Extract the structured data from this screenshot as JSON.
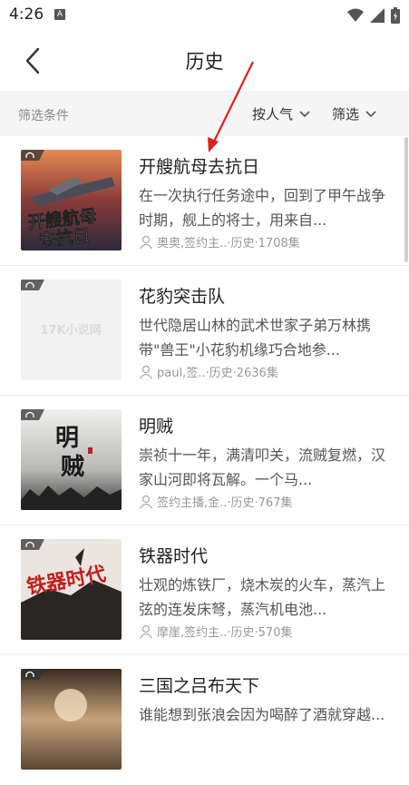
{
  "status": {
    "time": "4:26"
  },
  "header": {
    "title": "历史"
  },
  "filter": {
    "label": "筛选条件",
    "sort": "按人气",
    "filter": "筛选"
  },
  "items": [
    {
      "title": "开艘航母去抗日",
      "desc": "在一次执行任务途中，回到了甲午战争时期，舰上的将士，用来自...",
      "meta": "奥奥,签约主..·历史·1708集",
      "cover_text": "开艘航母去抗日"
    },
    {
      "title": "花豹突击队",
      "desc": "世代隐居山林的武术世家子弟万林携带\"兽王\"小花豹机缘巧合地参...",
      "meta": "paul,签..·历史·2636集",
      "cover_text": "17K小说网"
    },
    {
      "title": "明贼",
      "desc": "崇祯十一年，满清叩关，流贼复燃，汉家山河即将瓦解。一个马...",
      "meta": "签约主播,金..·历史·767集",
      "cover_text": "明贼"
    },
    {
      "title": "铁器时代",
      "desc": "壮观的炼铁厂，烧木炭的火车，蒸汽上弦的连发床弩，蒸汽机电池...",
      "meta": "摩崖,签约主..·历史·570集",
      "cover_text": "铁器时代"
    },
    {
      "title": "三国之吕布天下",
      "desc": "谁能想到张浪会因为喝醉了酒就穿越...",
      "meta": "",
      "cover_text": ""
    }
  ]
}
